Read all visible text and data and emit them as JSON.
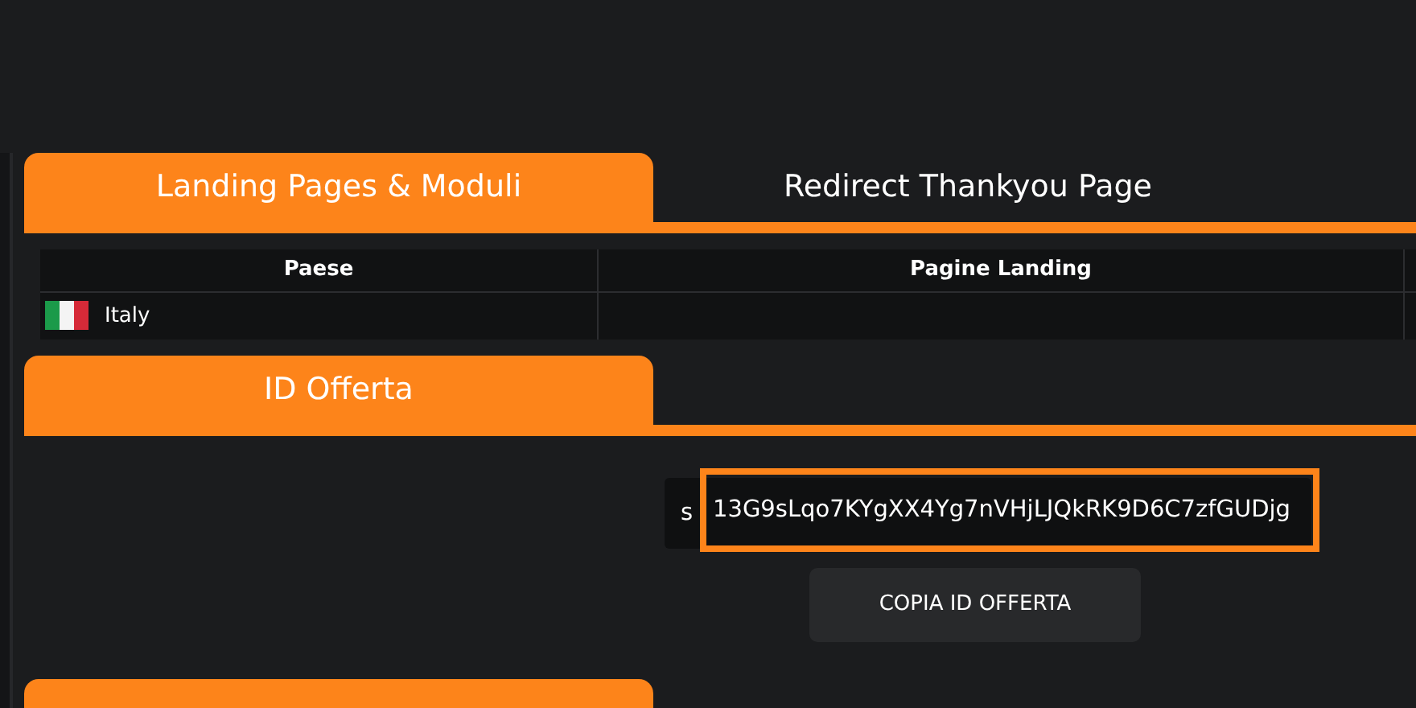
{
  "top_tabs": [
    {
      "label": "Landing Pages & Moduli",
      "selected": true
    },
    {
      "label": "Redirect Thankyou Page",
      "selected": false
    }
  ],
  "table": {
    "columns": [
      "Paese",
      "Pagine Landing"
    ],
    "rows": [
      {
        "country": "Italy"
      }
    ]
  },
  "offer_section": {
    "tab": "ID Offerta",
    "offer_id_prefix": "s",
    "offer_id": "13G9sLqo7KYgXX4Yg7nVHjLJQkRK9D6C7zfGUDjg",
    "highlighted": true,
    "button": "COPIA ID OFFERTA"
  }
}
